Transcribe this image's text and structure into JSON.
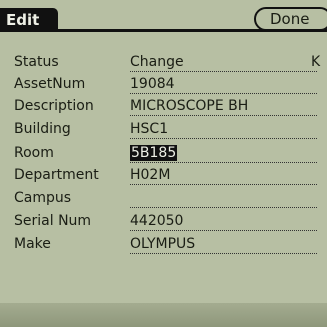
{
  "header": {
    "title": "Edit",
    "done_label": "Done"
  },
  "status": {
    "label": "Status",
    "value": "Change",
    "trailing": "K"
  },
  "fields": [
    {
      "label": "AssetNum",
      "value": "19084"
    },
    {
      "label": "Description",
      "value": "MICROSCOPE BH"
    },
    {
      "label": "Building",
      "value": "HSC1"
    },
    {
      "label": "Room",
      "value": "5B185",
      "selected": true
    },
    {
      "label": "Department",
      "value": "H02M"
    },
    {
      "label": "Campus",
      "value": ""
    },
    {
      "label": "Serial Num",
      "value": "442050"
    },
    {
      "label": "Make",
      "value": "OLYMPUS"
    }
  ]
}
